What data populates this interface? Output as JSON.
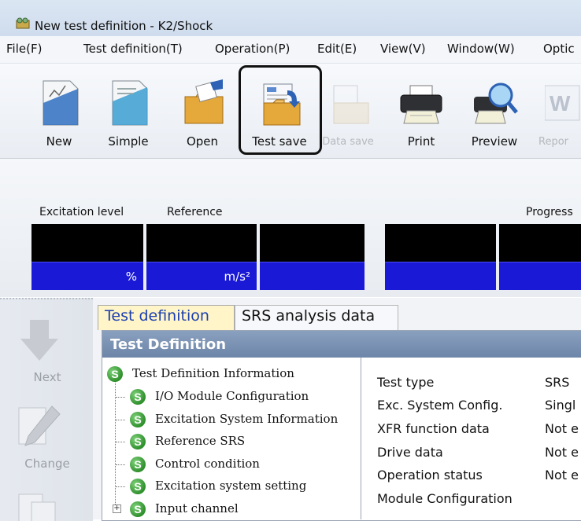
{
  "window": {
    "title": "New test definition - K2/Shock"
  },
  "menu": [
    "File(F)",
    "Test definition(T)",
    "Operation(P)",
    "Edit(E)",
    "View(V)",
    "Window(W)",
    "Optic"
  ],
  "toolbar": {
    "new": "New",
    "simple": "Simple",
    "open": "Open",
    "test_save": "Test save",
    "data_save": "Data save",
    "print": "Print",
    "preview": "Preview",
    "report": "Repor"
  },
  "status": {
    "excitation_level": "Excitation level",
    "reference": "Reference",
    "progress": "Progress",
    "unit_percent": "%",
    "unit_accel": "m/s²"
  },
  "nav": {
    "next": "Next",
    "change": "Change"
  },
  "tabs": {
    "test_definition": "Test definition",
    "srs_analysis": "SRS analysis data"
  },
  "section": {
    "title": "Test Definition"
  },
  "tree": [
    "Test Definition Information",
    "I/O Module Configuration",
    "Excitation System Information",
    "Reference SRS",
    "Control condition",
    "Excitation system setting",
    "Input channel"
  ],
  "details": {
    "labels": [
      "Test type",
      "Exc. System Config.",
      "XFR function data",
      "Drive data",
      "Operation status",
      "Module Configuration"
    ],
    "values": [
      "SRS",
      "Singl",
      "Not e",
      "Not e",
      "Not e"
    ]
  },
  "colors": {
    "meter_bg": "#000000",
    "meter_unit": "#1a1ad6",
    "active_tab": "#fff5c8",
    "section_header": "#7a91b3",
    "badge": "#3a9a36"
  }
}
